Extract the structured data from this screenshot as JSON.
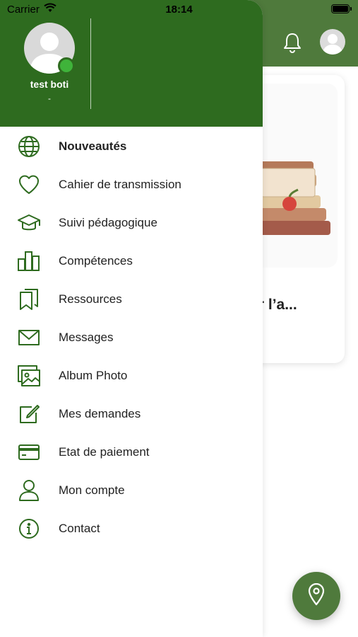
{
  "status_bar": {
    "carrier": "Carrier",
    "time": "18:14"
  },
  "user": {
    "name": "test boti",
    "subtitle": "-"
  },
  "background": {
    "card_title": "rer l’a..."
  },
  "menu": [
    {
      "label": "Nouveautés",
      "icon": "globe-icon",
      "active": true
    },
    {
      "label": "Cahier de transmission",
      "icon": "heart-icon"
    },
    {
      "label": "Suivi pédagogique",
      "icon": "graduation-cap-icon"
    },
    {
      "label": "Compétences",
      "icon": "bar-chart-icon"
    },
    {
      "label": "Ressources",
      "icon": "bookmarks-icon"
    },
    {
      "label": "Messages",
      "icon": "envelope-icon"
    },
    {
      "label": "Album Photo",
      "icon": "photo-album-icon"
    },
    {
      "label": "Mes demandes",
      "icon": "edit-icon"
    },
    {
      "label": "Etat de paiement",
      "icon": "credit-card-icon"
    },
    {
      "label": "Mon compte",
      "icon": "user-icon"
    },
    {
      "label": "Contact",
      "icon": "info-icon"
    }
  ],
  "colors": {
    "drawer_header": "#2e6b1f",
    "app_header": "#4f7a3c",
    "icon": "#2e6b1f",
    "online": "#3fb33a"
  }
}
